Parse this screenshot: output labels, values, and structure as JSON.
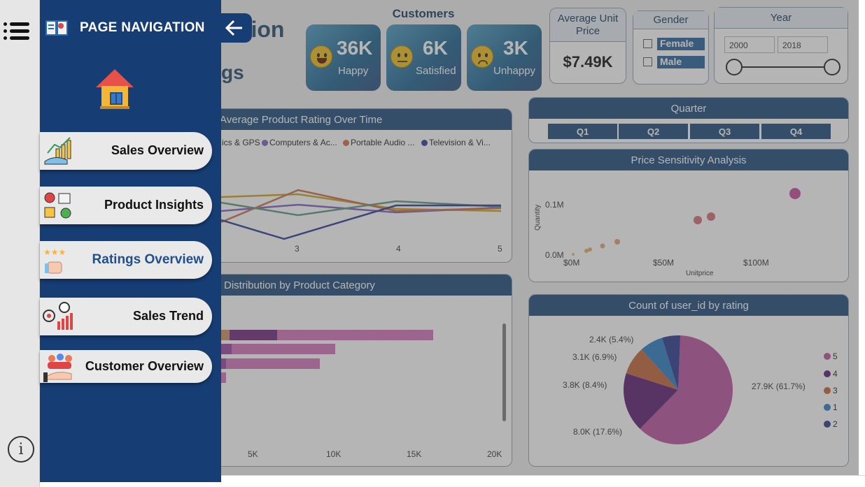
{
  "nav": {
    "title": "PAGE NAVIGATION",
    "items": [
      {
        "label": "Sales Overview",
        "active": false
      },
      {
        "label": "Product Insights",
        "active": false
      },
      {
        "label": "Ratings Overview",
        "active": true
      },
      {
        "label": "Sales Trend",
        "active": false
      },
      {
        "label": "Customer Overview",
        "active": false
      }
    ]
  },
  "page": {
    "title_partial": "ction",
    "subtitle_partial": "gs"
  },
  "customers": {
    "header": "Customers",
    "kpis": [
      {
        "value": "36K",
        "label": "Happy",
        "icon": "happy-face-icon"
      },
      {
        "value": "6K",
        "label": "Satisfied",
        "icon": "neutral-face-icon"
      },
      {
        "value": "3K",
        "label": "Unhappy",
        "icon": "sad-face-icon"
      }
    ]
  },
  "avg_price": {
    "title": "Average Unit Price",
    "value": "$7.49K"
  },
  "gender": {
    "title": "Gender",
    "options": [
      "Female",
      "Male"
    ]
  },
  "year": {
    "title": "Year",
    "from": "2000",
    "to": "2018"
  },
  "quarter": {
    "title": "Quarter",
    "options": [
      "Q1",
      "Q2",
      "Q3",
      "Q4"
    ]
  },
  "rating_over_time": {
    "title": "Average Product Rating Over Time",
    "legend": [
      "ics & GPS",
      "Computers & Ac...",
      "Portable Audio ...",
      "Television & Vi..."
    ],
    "colors": [
      "#d4aa30",
      "#8a6cc4",
      "#d07a58",
      "#3d4d9e"
    ],
    "x_ticks": [
      "3",
      "4",
      "5"
    ]
  },
  "distribution": {
    "title": "Distribution by Product Category",
    "x_ticks": [
      "5K",
      "10K",
      "15K",
      "20K"
    ]
  },
  "price_sensitivity": {
    "title": "Price Sensitivity Analysis",
    "y_ticks": [
      "0.1M",
      "0.0M"
    ],
    "x_ticks": [
      "$0M",
      "$50M",
      "$100M"
    ],
    "ylabel": "Quantity",
    "xlabel": "Unitprice"
  },
  "rating_pie": {
    "title": "Count of user_id by rating",
    "slices": [
      {
        "rating": "5",
        "label": "27.9K (61.7%)",
        "pct": 61.7,
        "color": "#c060a8"
      },
      {
        "rating": "4",
        "label": "8.0K (17.6%)",
        "pct": 17.6,
        "color": "#6a2f7e"
      },
      {
        "rating": "3",
        "label": "3.8K (8.4%)",
        "pct": 8.4,
        "color": "#c8724a"
      },
      {
        "rating": "1",
        "label": "3.1K (6.9%)",
        "pct": 6.9,
        "color": "#3a86c8"
      },
      {
        "rating": "2",
        "label": "2.4K (5.4%)",
        "pct": 5.4,
        "color": "#3c4a9a"
      }
    ]
  }
}
